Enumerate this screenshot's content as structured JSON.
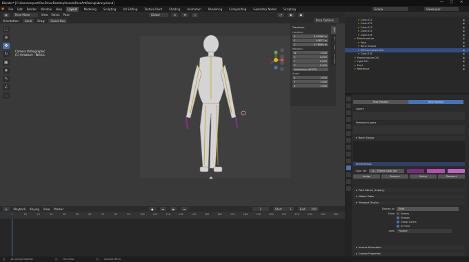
{
  "window": {
    "title": "Blender* [C:\\Users\\mrport\\OneDrive\\Desktop\\Assets\\PoseArt\\PosingLibrary.blend]"
  },
  "menu": [
    "File",
    "Edit",
    "Render",
    "Window",
    "Help"
  ],
  "workspaces": [
    "Layout",
    "Modeling",
    "Sculpting",
    "UV Editing",
    "Texture Paint",
    "Shading",
    "Animation",
    "Rendering",
    "Compositing",
    "Geometry Nodes",
    "Scripting"
  ],
  "active_workspace": "Layout",
  "scene": {
    "scene_label": "Scene",
    "view_layer_label": "ViewLayer"
  },
  "viewport_header": {
    "mode": "Pose Mode",
    "items": [
      "View",
      "Select",
      "Pose"
    ],
    "transform": "Global"
  },
  "viewport_header2": {
    "orientation_label": "Orientation:",
    "orientation": "Local",
    "drag_label": "Drag:",
    "drag": "Select Box"
  },
  "viewport_info": {
    "line1": "Camera Orthographic",
    "line2": "(1) Armature : Wrist.L"
  },
  "pose_options": "Pose Options",
  "npanel": {
    "header": "Transform",
    "location_label": "Location:",
    "location": [
      {
        "axis": "X",
        "value": "0.93466 m"
      },
      {
        "axis": "Y",
        "value": "1.0877 m"
      },
      {
        "axis": "Z",
        "value": "0.76569 m"
      }
    ],
    "rotation_label": "Rotation:",
    "rotation": [
      {
        "axis": "W",
        "value": "1.000"
      },
      {
        "axis": "X",
        "value": "0.000"
      },
      {
        "axis": "Y",
        "value": "0.000"
      },
      {
        "axis": "Z",
        "value": "0.000"
      }
    ],
    "rotation_mode": "Quaternion (WXYZ)",
    "scale_label": "Scale:",
    "scale": [
      {
        "axis": "X",
        "value": "1.000"
      },
      {
        "axis": "Y",
        "value": "1.000"
      },
      {
        "axis": "Z",
        "value": "1.000"
      }
    ],
    "tabs": [
      "Item",
      "Tool",
      "View",
      "Animation"
    ]
  },
  "outliner": {
    "items": [
      {
        "label": "Cube.011",
        "indent": 3
      },
      {
        "label": "Cube.012",
        "indent": 3
      },
      {
        "label": "Cube.013",
        "indent": 3
      },
      {
        "label": "Cube.015",
        "indent": 3
      },
      {
        "label": "Cube.016",
        "indent": 3
      },
      {
        "label": "PoseArmature",
        "indent": 2
      },
      {
        "label": "Pose",
        "indent": 3
      },
      {
        "label": "Bone Groups",
        "indent": 3
      },
      {
        "label": "HIPS.armature.000",
        "indent": 3
      },
      {
        "label": "Cube.018",
        "indent": 3
      },
      {
        "label": "PoseArmature.001",
        "indent": 2
      },
      {
        "label": "Light.001",
        "indent": 2
      },
      {
        "label": "Point",
        "indent": 2
      },
      {
        "label": "Reference",
        "indent": 2
      }
    ]
  },
  "properties": {
    "pose_position": "Pose Position",
    "rest_position": "Rest Position",
    "layers_label": "Layers",
    "protected_layers_label": "Protected Layers",
    "bone_groups_header": "Bone Groups",
    "bone_group_item": "BlGsketelbox",
    "color_set_label": "Color Set",
    "color_set_value": "11 - Theme Color Set",
    "assign": "Assign",
    "remove": "Remove",
    "select": "Select",
    "deselect": "Deselect",
    "pose_library": "Pose Library (Legacy)",
    "motion_paths": "Motion Paths",
    "viewport_display": "Viewport Display",
    "display_as_label": "Display As",
    "display_as_value": "Stick",
    "show_label": "Show",
    "show_options": [
      "Names",
      "Shapes",
      "Group Colors",
      "In Front"
    ],
    "axes_label": "Axes",
    "axes_value": "Position",
    "inverse_kinematics": "Inverse Kinematics",
    "custom_properties": "Custom Properties"
  },
  "timeline": {
    "header": [
      "Playback",
      "Keying",
      "View",
      "Marker"
    ],
    "current_frame": "1",
    "start_label": "Start",
    "start": "1",
    "end_label": "End",
    "end": "250",
    "ticks": [
      "1",
      "10",
      "20",
      "30",
      "40",
      "50",
      "60",
      "70",
      "80",
      "90",
      "100",
      "110",
      "120",
      "130",
      "140",
      "150",
      "160",
      "170",
      "180",
      "190",
      "200",
      "210",
      "220",
      "230",
      "240",
      "250"
    ]
  },
  "statusbar": [
    "Set Active Modifier",
    "Pan View",
    "Context Menu"
  ],
  "colors": {
    "accent": "#4772b3",
    "bone": "#c7a400",
    "group": "#8a2a8a"
  }
}
